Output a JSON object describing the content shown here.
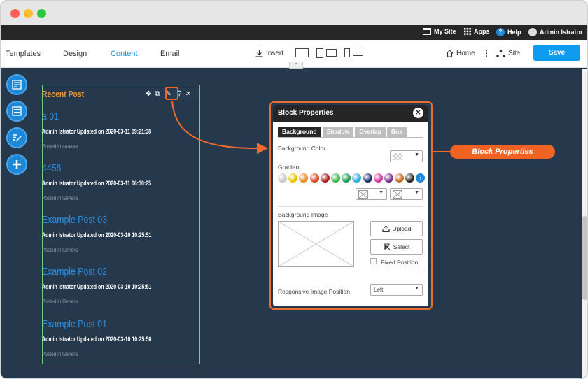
{
  "topbar": {
    "my_site": "My Site",
    "apps": "Apps",
    "help": "Help",
    "user": "Admin Istrator"
  },
  "toolbar": {
    "tabs": [
      "Templates",
      "Design",
      "Content",
      "Email"
    ],
    "active_tab": "Content",
    "insert_label": "Insert",
    "home_label": "Home",
    "site_label": "Site",
    "save_label": "Save"
  },
  "block": {
    "title": "Recent Post",
    "posts": [
      {
        "title": "a 01",
        "meta": "Admin Istrator Updated on 2020-03-11 09:21:38",
        "category": "Posted in aaaaaa"
      },
      {
        "title": "4456",
        "meta": "Admin Istrator Updated on 2020-03-11 06:30:25",
        "category": "Posted in General"
      },
      {
        "title": "Example Post 03",
        "meta": "Admin Istrator Updated on 2020-03-10 10:25:51",
        "category": "Posted in General"
      },
      {
        "title": "Example Post 02",
        "meta": "Admin Istrator Updated on 2020-03-10 10:25:51",
        "category": "Posted in General"
      },
      {
        "title": "Example Post 01",
        "meta": "Admin Istrator Updated on 2020-03-10 10:25:50",
        "category": "Posted in General"
      }
    ]
  },
  "dialog": {
    "title": "Block Properties",
    "tabs": [
      "Background",
      "Shadow",
      "Overlap",
      "Box"
    ],
    "active_tab": "Background",
    "background_color_label": "Background Color",
    "gradient_label": "Gradient",
    "gradient_colors": [
      "#c8c8c8",
      "#e8c200",
      "#e8892a",
      "#d9451e",
      "#b31c1c",
      "#3ab54a",
      "#1e9a54",
      "#2ba8e0",
      "#1c2e6e",
      "#d43292",
      "#7a2a8c",
      "#c86a28",
      "#222222"
    ],
    "background_image_label": "Background Image",
    "upload_label": "Upload",
    "select_label": "Select",
    "fixed_position_label": "Fixed Position",
    "responsive_label": "Responsive Image Position",
    "responsive_value": "Left"
  },
  "callout": {
    "label": "Block Properties",
    "color": "#f16322"
  }
}
